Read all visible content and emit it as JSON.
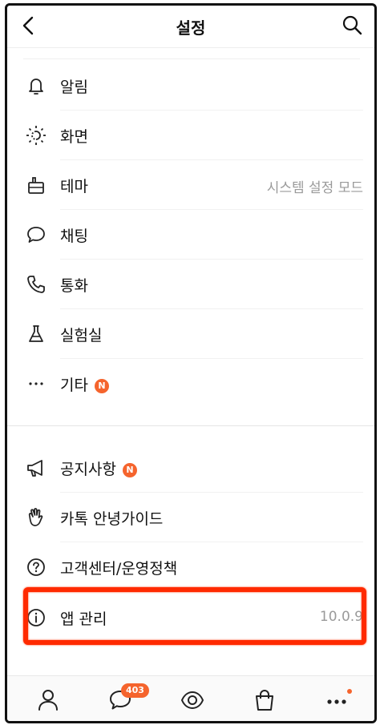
{
  "header": {
    "title": "설정"
  },
  "menu": [
    {
      "label": "알림",
      "value": "",
      "badge": ""
    },
    {
      "label": "화면",
      "value": "",
      "badge": ""
    },
    {
      "label": "테마",
      "value": "시스템 설정 모드",
      "badge": ""
    },
    {
      "label": "채팅",
      "value": "",
      "badge": ""
    },
    {
      "label": "통화",
      "value": "",
      "badge": ""
    },
    {
      "label": "실험실",
      "value": "",
      "badge": ""
    },
    {
      "label": "기타",
      "value": "",
      "badge": "N"
    }
  ],
  "menu2": [
    {
      "label": "공지사항",
      "value": "",
      "badge": "N"
    },
    {
      "label": "카톡 안녕가이드",
      "value": "",
      "badge": ""
    },
    {
      "label": "고객센터/운영정책",
      "value": "",
      "badge": ""
    },
    {
      "label": "앱 관리",
      "value": "10.0.9",
      "badge": ""
    }
  ],
  "tabbar": {
    "chat_badge": "403"
  },
  "colors": {
    "accent": "#f5642d",
    "highlight": "#ff2a00"
  }
}
